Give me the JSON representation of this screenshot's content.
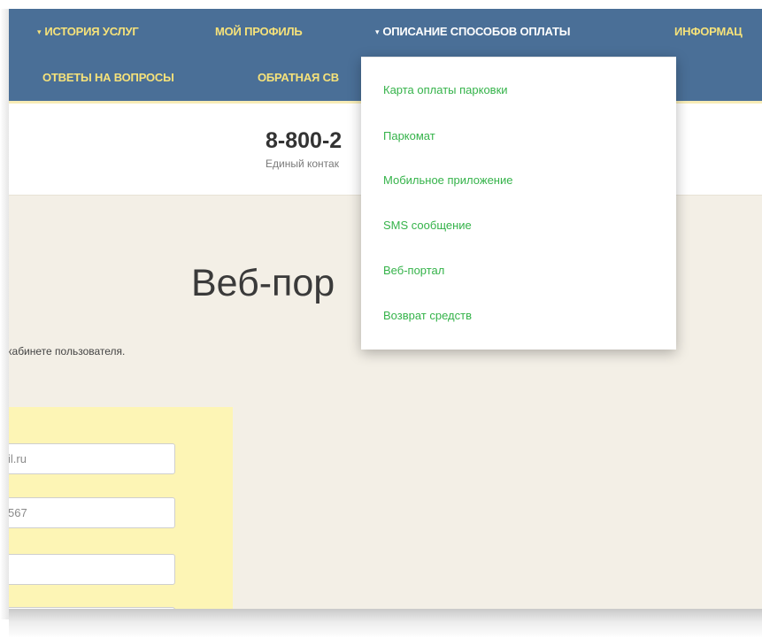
{
  "nav": {
    "items": [
      {
        "label": "ИСТОРИЯ УСЛУГ",
        "caret": "▾"
      },
      {
        "label": "МОЙ ПРОФИЛЬ"
      },
      {
        "label": "ОПИСАНИЕ СПОСОБОВ ОПЛАТЫ",
        "caret": "▾"
      },
      {
        "label": "ИНФОРМАЦ"
      },
      {
        "label": "ОТВЕТЫ НА ВОПРОСЫ"
      },
      {
        "label": "ОБРАТНАЯ СВ"
      }
    ]
  },
  "dropdown": {
    "items": [
      "Карта оплаты парковки",
      "Паркомат",
      "Мобильное приложение",
      "SMS сообщение",
      "Веб-портал",
      "Возврат средств"
    ]
  },
  "contact": {
    "phone": "8-800-2",
    "subtitle": "Единый контак"
  },
  "page": {
    "title": "Веб-пор",
    "intro": "кабинете пользователя."
  },
  "form": {
    "email_value": "il.ru",
    "phone_value": "567",
    "field3_value": "",
    "field4_value": ""
  },
  "colors": {
    "nav_bg": "#4a6f97",
    "nav_text": "#f6e27a",
    "nav_active": "#ffffff",
    "dropdown_link": "#35b34a",
    "form_bg": "#fdf5b5",
    "page_bg": "#f3efe6"
  }
}
